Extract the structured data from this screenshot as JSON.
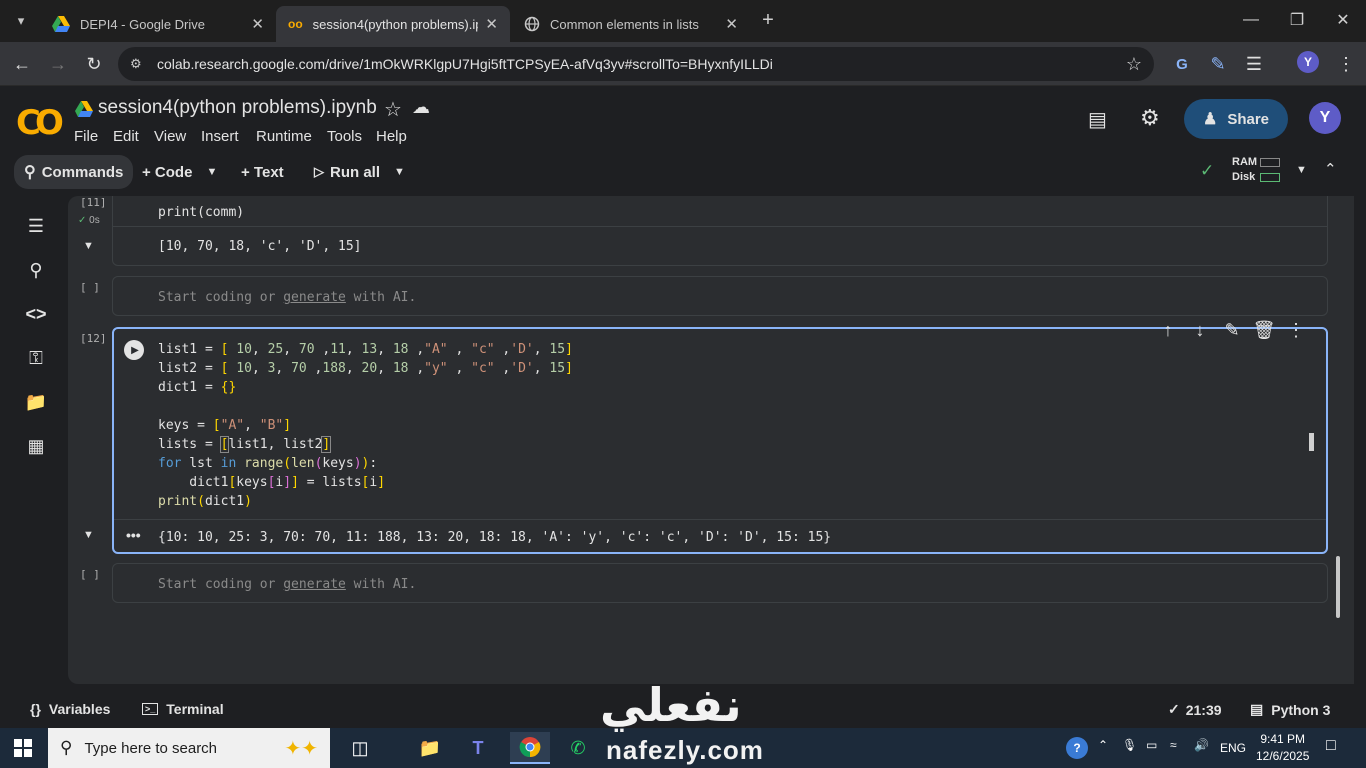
{
  "browser": {
    "tabs": [
      {
        "label": "DEPI4 - Google Drive",
        "icon": "google-drive-icon"
      },
      {
        "label": "session4(python problems).ipyn",
        "icon": "colab-icon"
      },
      {
        "label": "Common elements in lists",
        "icon": "globe-icon"
      }
    ],
    "url": "colab.research.google.com/drive/1mOkWRKlgpU7Hgi5ftTCPSyEA-afVq3yv#scrollTo=BHyxnfyILLDi",
    "profile_initial": "Y"
  },
  "colab": {
    "logo": "CO",
    "title": "session4(python problems).ipynb",
    "menu": [
      "File",
      "Edit",
      "View",
      "Insert",
      "Runtime",
      "Tools",
      "Help"
    ],
    "share_label": "Share",
    "avatar_initial": "Y",
    "toolbar": {
      "commands": "Commands",
      "code": "+ Code",
      "text": "+ Text",
      "run_all": "Run all",
      "ram": "RAM",
      "disk": "Disk"
    }
  },
  "cells": {
    "cell1": {
      "count": "[11]",
      "status": "0s",
      "code": "print(comm)",
      "output": "[10, 70, 18, 'c', 'D', 15]"
    },
    "empty1": {
      "count": "[ ]",
      "placeholder_start": "Start coding or ",
      "placeholder_link": "generate",
      "placeholder_end": " with AI."
    },
    "cell2": {
      "count": "[12]",
      "output": "{10: 10, 25: 3, 70: 70, 11: 188, 13: 20, 18: 18, 'A': 'y', 'c': 'c', 'D': 'D', 15: 15}"
    },
    "empty2": {
      "count": "[ ]",
      "placeholder_start": "Start coding or ",
      "placeholder_link": "generate",
      "placeholder_end": " with AI."
    }
  },
  "statusbar": {
    "variables": "Variables",
    "terminal": "Terminal",
    "time": "21:39",
    "kernel": "Python 3"
  },
  "taskbar": {
    "search_placeholder": "Type here to search",
    "lang": "ENG",
    "time": "9:41 PM",
    "date": "12/6/2025"
  },
  "watermark": {
    "arabic": "نفعلي",
    "site": "nafezly.com"
  }
}
